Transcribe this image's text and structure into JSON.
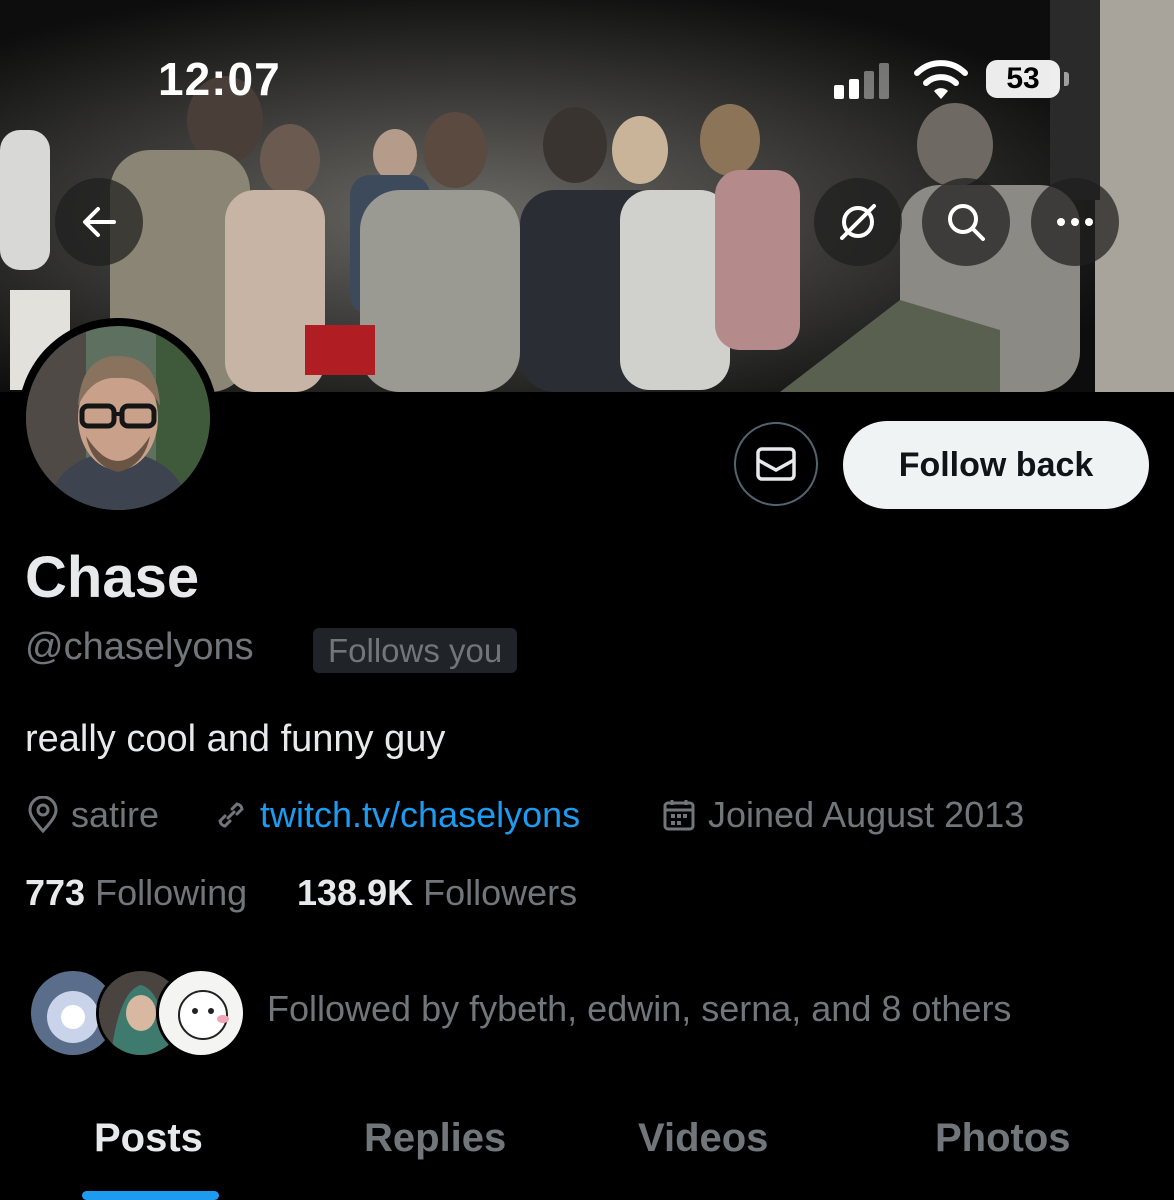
{
  "status_bar": {
    "time": "12:07",
    "battery": "53"
  },
  "header": {
    "banner": "photo-of-people-at-night-party",
    "buttons": [
      "back-arrow-icon",
      "grok-icon",
      "search-icon",
      "more-icon"
    ]
  },
  "profile": {
    "display_name": "Chase",
    "handle": "@chaselyons",
    "follows_you_badge": "Follows you",
    "bio": "really cool and funny guy",
    "location": "satire",
    "website": "twitch.tv/chaselyons",
    "joined": "Joined August 2013"
  },
  "actions": {
    "follow_back": "Follow back"
  },
  "stats": {
    "following_count": "773",
    "following_label": "Following",
    "followers_count": "138.9K",
    "followers_label": "Followers"
  },
  "followed_by": {
    "text": "Followed by fybeth, edwin, serna, and 8 others"
  },
  "tabs": [
    {
      "label": "Posts",
      "active": true
    },
    {
      "label": "Replies",
      "active": false
    },
    {
      "label": "Videos",
      "active": false
    },
    {
      "label": "Photos",
      "active": false
    }
  ],
  "colors": {
    "accent": "#1d9bf0",
    "background": "#000000",
    "secondary_text": "#71767b",
    "primary_text": "#e7e9ea"
  }
}
